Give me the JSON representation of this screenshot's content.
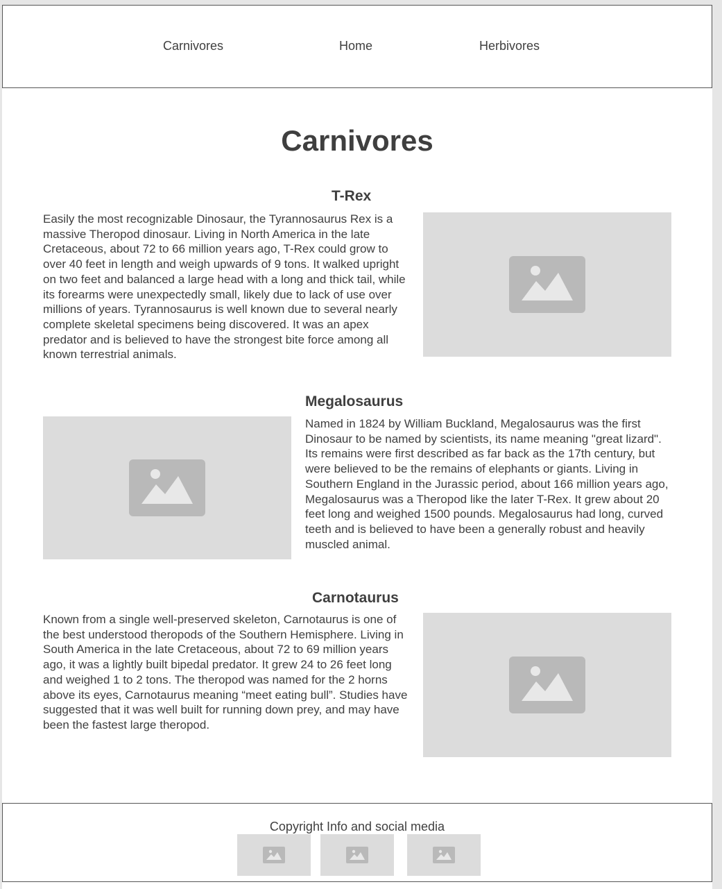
{
  "nav": {
    "links": [
      "Carnivores",
      "Home",
      "Herbivores"
    ]
  },
  "main": {
    "title": "Carnivores",
    "sections": [
      {
        "heading": "T-Rex",
        "text": "Easily the most recognizable Dinosaur, the Tyrannosaurus Rex is a massive Theropod dinosaur. Living in North America in the late Cretaceous, about 72 to 66 million years ago, T-Rex could grow to over 40 feet in length and weigh upwards of 9 tons. It walked upright on two feet and balanced a large head with a long and thick tail, while its forearms were unexpectedly small, likely due to lack of use over millions of years. Tyrannosaurus is well known due to several nearly complete skeletal specimens being discovered. It was an apex predator and is believed to have the strongest bite force among all known terrestrial animals.",
        "image_icon": "image-placeholder-icon"
      },
      {
        "heading": "Megalosaurus",
        "text": "Named in 1824 by William Buckland, Megalosaurus was the first Dinosaur to be named by scientists, its name meaning \"great lizard\". Its remains were first described as far back as the 17th century, but were believed to be the remains of elephants or giants. Living in Southern England in the Jurassic period, about 166 million years ago, Megalosaurus was a Theropod like the later T-Rex. It grew about 20 feet long and weighed 1500 pounds. Megalosaurus had long, curved teeth and is believed to have been a generally robust and heavily muscled animal.",
        "image_icon": "image-placeholder-icon"
      },
      {
        "heading": "Carnotaurus",
        "text": "Known from a single well-preserved skeleton, Carnotaurus is one of the best understood theropods of the Southern Hemisphere. Living in South America in the late Cretaceous, about 72 to 69 million years ago, it was a lightly built bipedal predator. It grew 24 to 26 feet long and weighed 1 to 2 tons. The theropod was named for the 2 horns above its eyes, Carnotaurus meaning “meet eating bull”. Studies have suggested that it was well built for running down prey, and may have been the fastest large theropod.",
        "image_icon": "image-placeholder-icon"
      }
    ]
  },
  "footer": {
    "text": "Copyright Info and social media",
    "social_icons": [
      "image-placeholder-icon",
      "image-placeholder-icon",
      "image-placeholder-icon"
    ]
  },
  "colors": {
    "text": "#3f3f3f",
    "placeholder_bg": "#dcdcdc",
    "placeholder_icon": "#b9b9b9",
    "border": "#555555"
  }
}
